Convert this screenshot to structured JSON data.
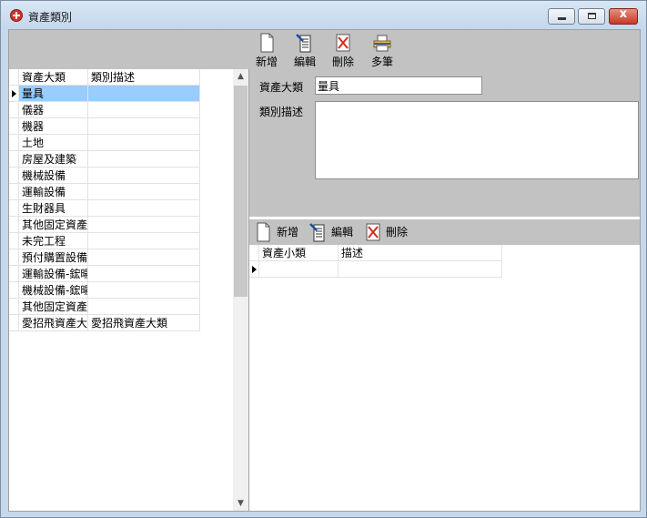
{
  "window": {
    "title": "資產類別",
    "min_glyph": "",
    "max_glyph": "",
    "close_glyph": "x"
  },
  "toolbar": {
    "add": "新增",
    "edit": "編輯",
    "delete": "刪除",
    "multi": "多筆"
  },
  "categories": {
    "headers": [
      "資產大類",
      "類別描述"
    ],
    "rows": [
      [
        "量具",
        ""
      ],
      [
        "儀器",
        ""
      ],
      [
        "機器",
        ""
      ],
      [
        "土地",
        ""
      ],
      [
        "房屋及建築",
        ""
      ],
      [
        "機械設備",
        ""
      ],
      [
        "運輸設備",
        ""
      ],
      [
        "生財器具",
        ""
      ],
      [
        "其他固定資產",
        ""
      ],
      [
        "未完工程",
        ""
      ],
      [
        "預付購置設備",
        ""
      ],
      [
        "運輸設備-鋐暘",
        ""
      ],
      [
        "機械設備-鋐暘",
        ""
      ],
      [
        "其他固定資產",
        ""
      ],
      [
        "愛招飛資產大",
        "愛招飛資產大類"
      ]
    ],
    "selected_index": 0
  },
  "form": {
    "category_label": "資產大類",
    "category_value": "量具",
    "description_label": "類別描述",
    "description_value": ""
  },
  "sub_toolbar": {
    "add": "新增",
    "edit": "編輯",
    "delete": "刪除"
  },
  "subcategories": {
    "headers": [
      "資產小類",
      "描述"
    ],
    "rows": [
      [
        "",
        ""
      ]
    ]
  },
  "colors": {
    "toolbar_bg": "#c2c2c2",
    "selection": "#99ccff",
    "close_button": "#c63a26"
  }
}
